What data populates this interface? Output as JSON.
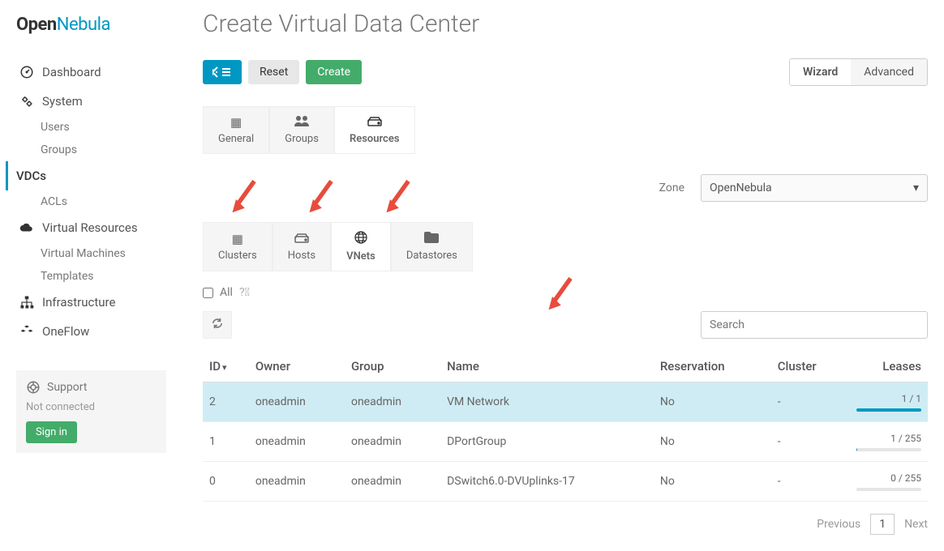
{
  "logo": {
    "open": "Open",
    "nebula": "Nebula"
  },
  "sidebar": {
    "items": [
      {
        "label": "Dashboard"
      },
      {
        "label": "System"
      },
      {
        "label": "Users"
      },
      {
        "label": "Groups"
      },
      {
        "label": "VDCs"
      },
      {
        "label": "ACLs"
      },
      {
        "label": "Virtual Resources"
      },
      {
        "label": "Virtual Machines"
      },
      {
        "label": "Templates"
      },
      {
        "label": "Infrastructure"
      },
      {
        "label": "OneFlow"
      }
    ]
  },
  "support": {
    "title": "Support",
    "status": "Not connected",
    "signin": "Sign in"
  },
  "page": {
    "title": "Create Virtual Data Center"
  },
  "toolbar": {
    "reset": "Reset",
    "create": "Create"
  },
  "wizard": {
    "wizard": "Wizard",
    "advanced": "Advanced"
  },
  "categoryTabs": [
    {
      "label": "General"
    },
    {
      "label": "Groups"
    },
    {
      "label": "Resources"
    }
  ],
  "zone": {
    "label": "Zone",
    "value": "OpenNebula"
  },
  "resourceTabs": [
    {
      "label": "Clusters"
    },
    {
      "label": "Hosts"
    },
    {
      "label": "VNets"
    },
    {
      "label": "Datastores"
    }
  ],
  "all": {
    "label": "All"
  },
  "search": {
    "placeholder": "Search"
  },
  "columns": {
    "id": "ID",
    "owner": "Owner",
    "group": "Group",
    "name": "Name",
    "reservation": "Reservation",
    "cluster": "Cluster",
    "leases": "Leases"
  },
  "rows": [
    {
      "id": "2",
      "owner": "oneadmin",
      "group": "oneadmin",
      "name": "VM Network",
      "reservation": "No",
      "cluster": "-",
      "leases": "1 / 1",
      "pct": 100,
      "selected": true
    },
    {
      "id": "1",
      "owner": "oneadmin",
      "group": "oneadmin",
      "name": "DPortGroup",
      "reservation": "No",
      "cluster": "-",
      "leases": "1 / 255",
      "pct": 1,
      "selected": false
    },
    {
      "id": "0",
      "owner": "oneadmin",
      "group": "oneadmin",
      "name": "DSwitch6.0-DVUplinks-17",
      "reservation": "No",
      "cluster": "-",
      "leases": "0 / 255",
      "pct": 0,
      "selected": false
    }
  ],
  "pager": {
    "prev": "Previous",
    "page": "1",
    "next": "Next"
  }
}
